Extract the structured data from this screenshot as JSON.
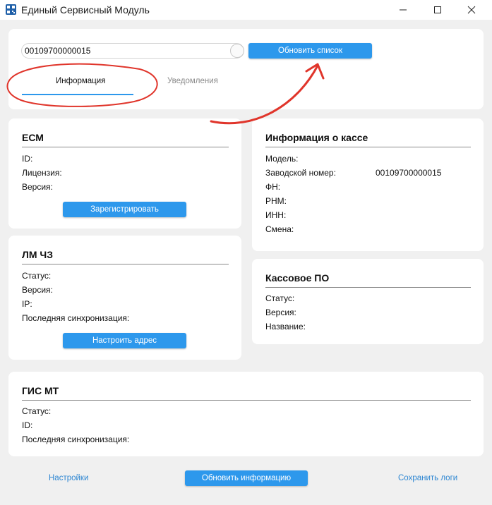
{
  "window": {
    "title": "Единый Сервисный Модуль",
    "controls": [
      "minimize",
      "maximize",
      "close"
    ]
  },
  "search": {
    "serial_value": "00109700000015",
    "refresh_list_label": "Обновить список"
  },
  "tabs": [
    {
      "label": "Информация",
      "active": true
    },
    {
      "label": "Уведомления",
      "active": false
    }
  ],
  "esm": {
    "title": "ЕСМ",
    "fields": {
      "id": "ID:",
      "license": "Лицензия:",
      "version": "Версия:"
    },
    "register_label": "Зарегистрировать"
  },
  "lm": {
    "title": "ЛМ ЧЗ",
    "fields": {
      "status": "Статус:",
      "version": "Версия:",
      "ip": "IP:",
      "last_sync": "Последняя синхронизация:"
    },
    "configure_label": "Настроить адрес"
  },
  "cash_info": {
    "title": "Информация о кассе",
    "fields": {
      "model": "Модель:",
      "serial": "Заводской номер:",
      "fn": "ФН:",
      "rnm": "РНМ:",
      "inn": "ИНН:",
      "shift": "Смена:"
    },
    "serial_value": "00109700000015"
  },
  "cash_software": {
    "title": "Кассовое ПО",
    "fields": {
      "status": "Статус:",
      "version": "Версия:",
      "name": "Название:"
    }
  },
  "gis": {
    "title": "ГИС МТ",
    "fields": {
      "status": "Статус:",
      "id": "ID:",
      "last_sync": "Последняя синхронизация:"
    }
  },
  "footer": {
    "settings_label": "Настройки",
    "refresh_info_label": "Обновить информацию",
    "save_logs_label": "Сохранить логи"
  },
  "colors": {
    "accent": "#2d98ec",
    "link": "#2d86d2",
    "annotation": "#e0352b",
    "background": "#f0f0f0"
  },
  "icons": {
    "app": "qr-code-icon",
    "minimize": "minimize-icon",
    "maximize": "maximize-icon",
    "close": "close-icon"
  }
}
